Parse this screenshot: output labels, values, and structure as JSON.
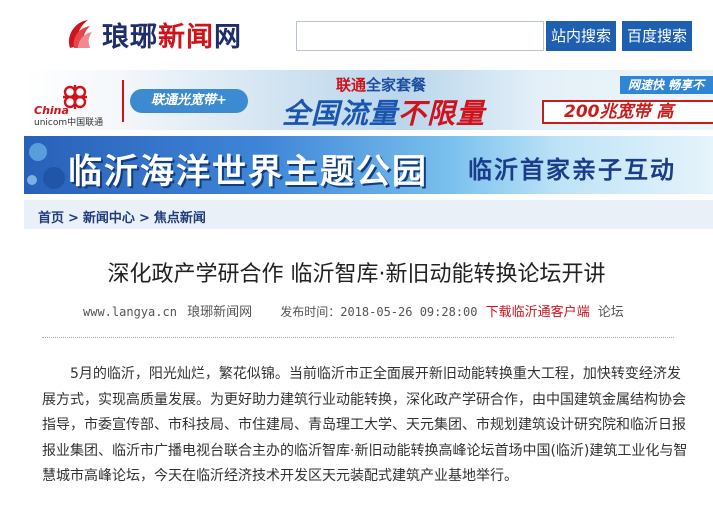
{
  "header": {
    "site_name_part1": "琅琊",
    "site_name_part2": "新闻",
    "site_name_part3": "网",
    "search": {
      "value": "",
      "placeholder": ""
    },
    "btn_site_search": "站内搜索",
    "btn_baidu_search": "百度搜索"
  },
  "ad_unicom": {
    "brand_china": "China",
    "brand_unicom": "unicom中国联通",
    "product": "联通光宽带+",
    "headline_top_red": "联通",
    "headline_top_blue": "全家套餐",
    "headline_main_blue": "全国流量",
    "headline_main_red": "不限量",
    "right_top": "网速快 畅享不",
    "right_bottom": "200兆宽带 高"
  },
  "ad_park": {
    "title": "临沂海洋世界主题公园",
    "subtitle": "临沂首家亲子互动"
  },
  "breadcrumb": {
    "home": "首页",
    "sep1": ">",
    "news_center": "新闻中心",
    "sep2": ">",
    "focus_news": "焦点新闻"
  },
  "article": {
    "title": "深化政产学研合作 临沂智库·新旧动能转换论坛开讲",
    "source_url": "www.langya.cn",
    "source_name": "琅琊新闻网",
    "published": "发布时间：2018-05-26 09:28:00",
    "download_link": "下载临沂通客户端",
    "forum_link": "论坛",
    "paragraph": "5月的临沂，阳光灿烂，繁花似锦。当前临沂市正全面展开新旧动能转换重大工程，加快转变经济发展方式，实现高质量发展。为更好助力建筑行业动能转换，深化政产学研合作，由中国建筑金属结构协会指导，市委宣传部、市科技局、市住建局、青岛理工大学、天元集团、市规划建筑设计研究院和临沂日报报业集团、临沂市广播电视台联合主办的临沂智库·新旧动能转换高峰论坛首场中国(临沂)建筑工业化与智慧城市高峰论坛，今天在临沂经济技术开发区天元装配式建筑产业基地举行。"
  },
  "colors": {
    "brand_blue": "#1f2e6b",
    "brand_red": "#d0121b",
    "button_blue": "#1f5fb0",
    "crumb_bg": "#eaf0f8"
  },
  "icons": [
    "swirl-logo-icon",
    "unicom-knot-icon"
  ]
}
